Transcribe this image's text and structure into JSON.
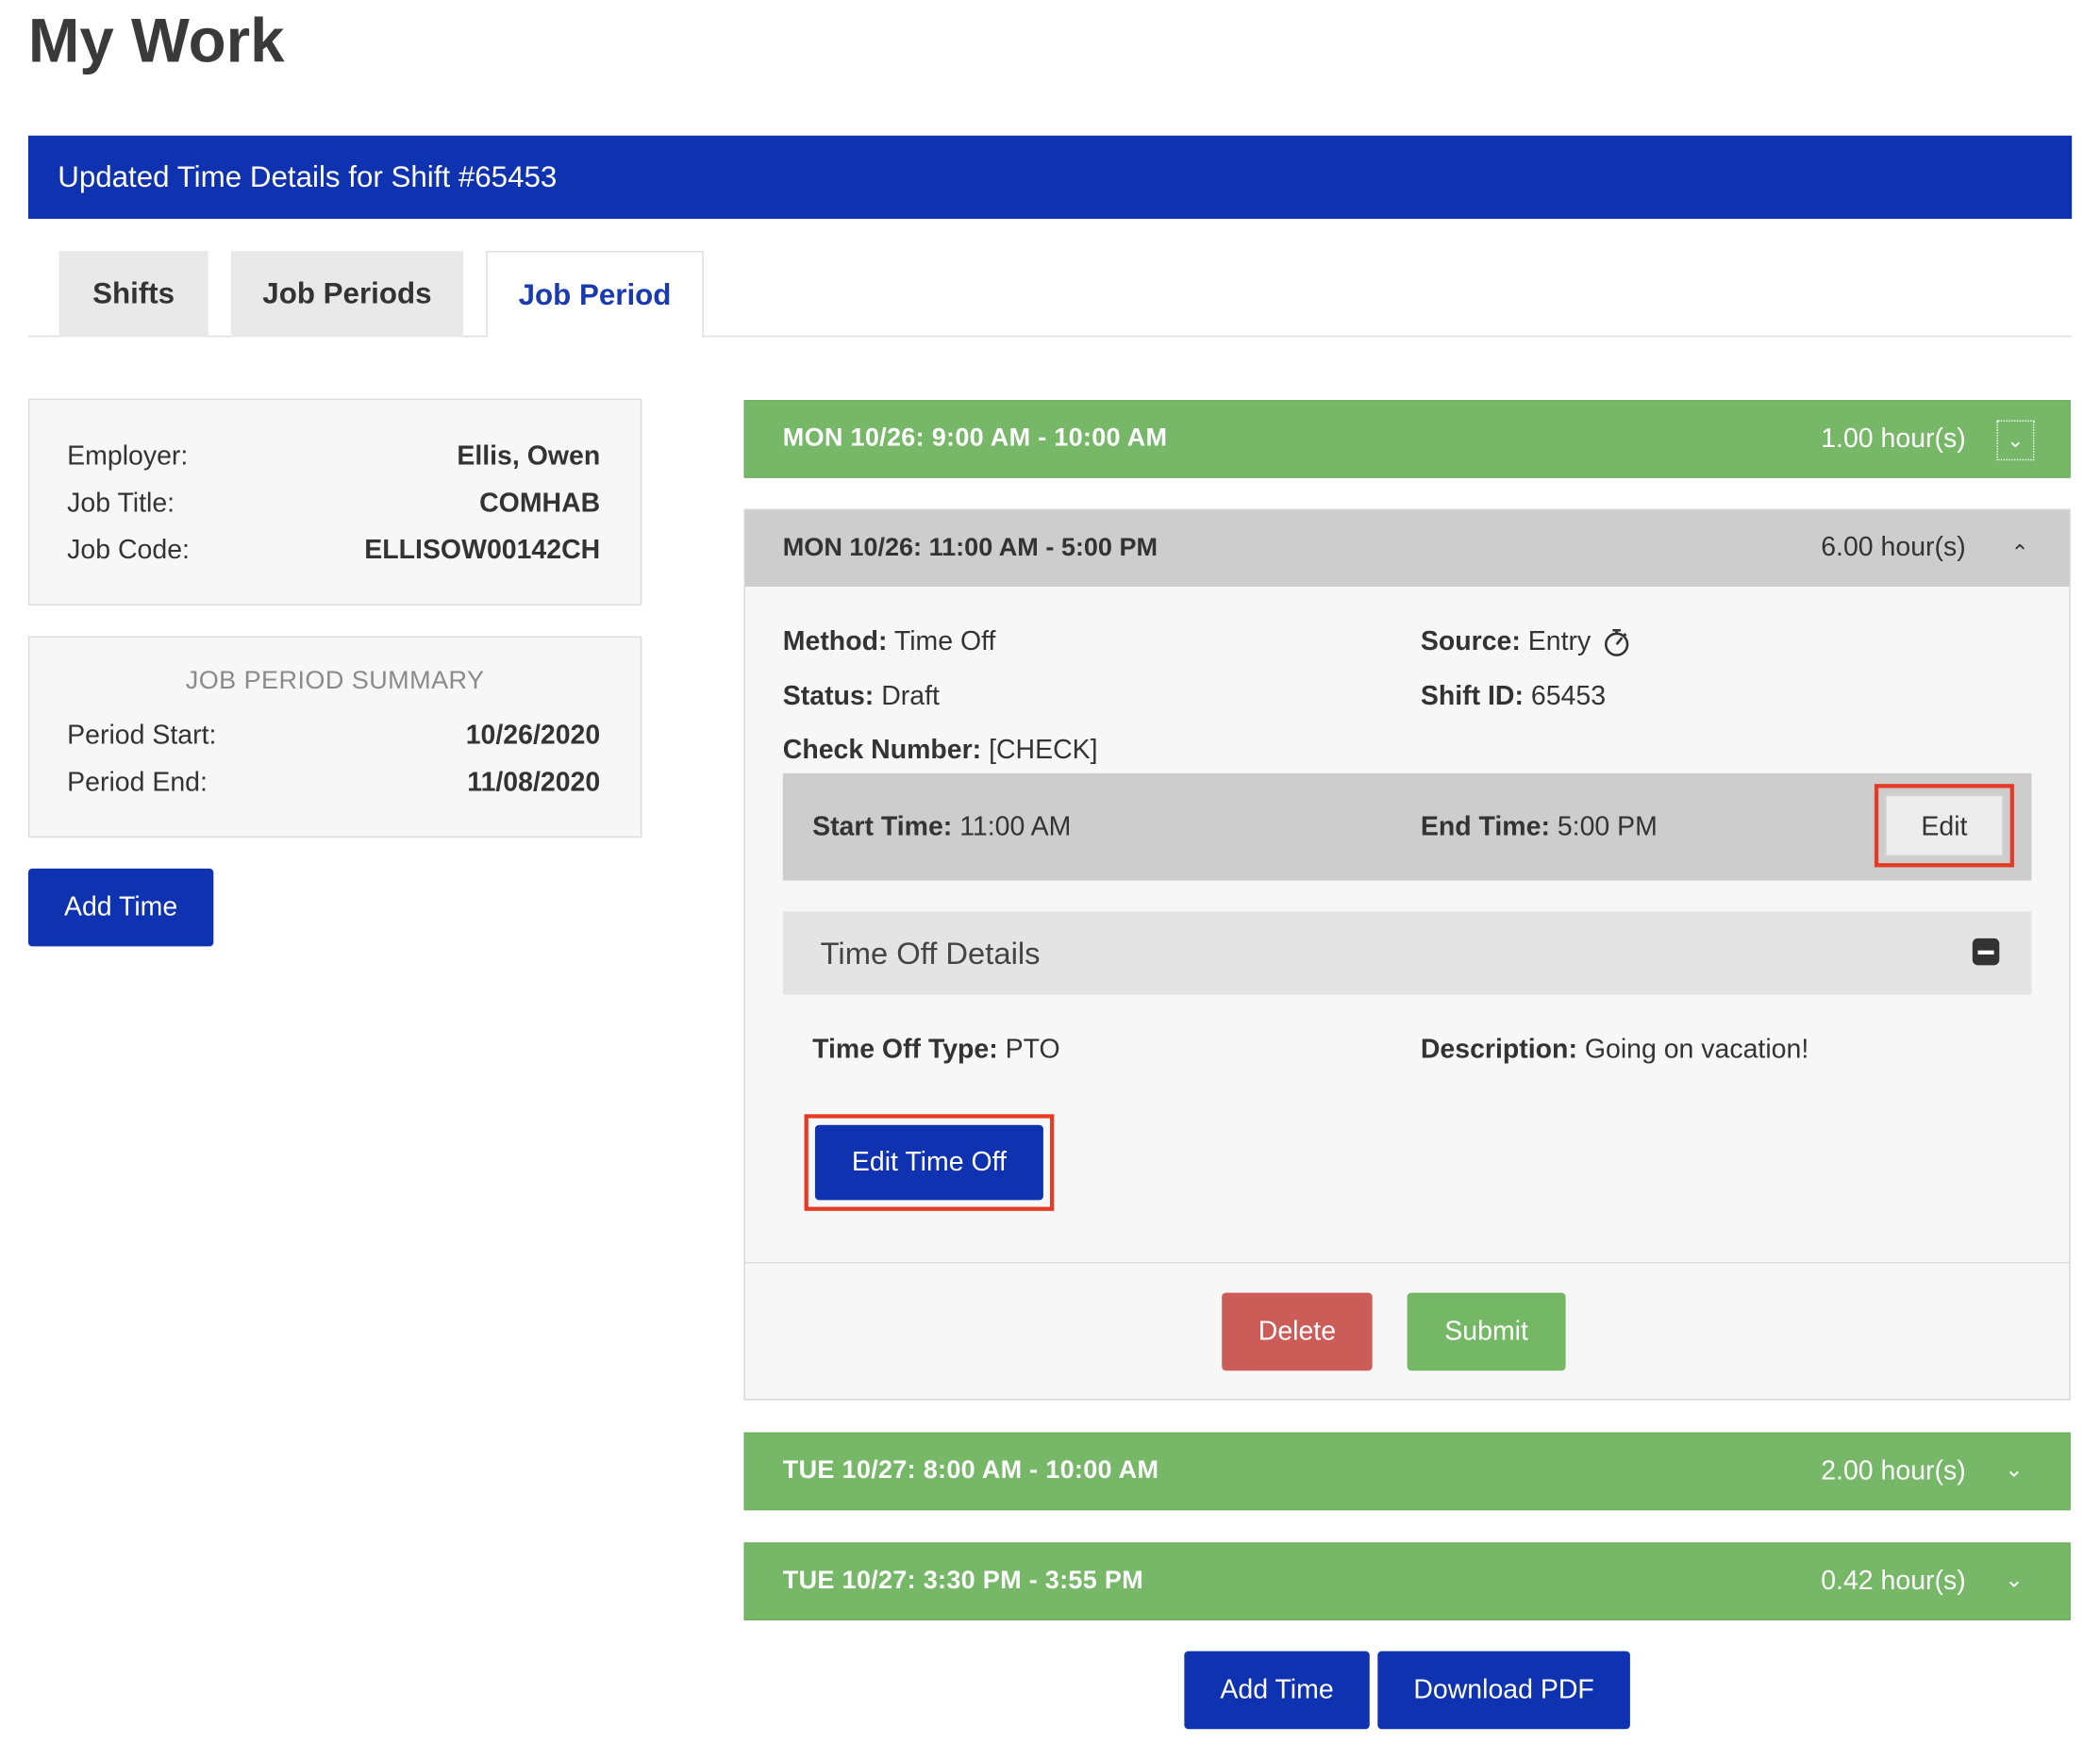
{
  "page": {
    "title": "My Work"
  },
  "banner": {
    "text": "Updated Time Details for Shift #65453"
  },
  "tabs": [
    {
      "label": "Shifts"
    },
    {
      "label": "Job Periods"
    },
    {
      "label": "Job Period"
    }
  ],
  "employee": {
    "employer_label": "Employer:",
    "employer_value": "Ellis, Owen",
    "job_title_label": "Job Title:",
    "job_title_value": "COMHAB",
    "job_code_label": "Job Code:",
    "job_code_value": "ELLISOW00142CH"
  },
  "summary": {
    "title": "JOB PERIOD SUMMARY",
    "start_label": "Period Start:",
    "start_value": "10/26/2020",
    "end_label": "Period End:",
    "end_value": "11/08/2020"
  },
  "left_add_time": "Add Time",
  "shifts": [
    {
      "label": "MON 10/26: 9:00 AM - 10:00 AM",
      "hours": "1.00 hour(s)",
      "chevron": "⌄"
    },
    {
      "label": "MON 10/26: 11:00 AM - 5:00 PM",
      "hours": "6.00 hour(s)",
      "chevron": "⌃"
    },
    {
      "label": "TUE 10/27: 8:00 AM - 10:00 AM",
      "hours": "2.00 hour(s)",
      "chevron": "⌄"
    },
    {
      "label": "TUE 10/27: 3:30 PM - 3:55 PM",
      "hours": "0.42 hour(s)",
      "chevron": "⌄"
    }
  ],
  "detail": {
    "method_label": "Method:",
    "method_value": "Time Off",
    "source_label": "Source:",
    "source_value": "Entry",
    "status_label": "Status:",
    "status_value": "Draft",
    "shift_id_label": "Shift ID:",
    "shift_id_value": "65453",
    "check_label": "Check Number:",
    "check_value": "[CHECK]",
    "start_label": "Start Time:",
    "start_value": "11:00 AM",
    "end_label": "End Time:",
    "end_value": "5:00 PM",
    "edit_button": "Edit",
    "time_off_header": "Time Off Details",
    "type_label": "Time Off Type:",
    "type_value": "PTO",
    "desc_label": "Description:",
    "desc_value": "Going on vacation!",
    "edit_time_off_button": "Edit Time Off",
    "delete_button": "Delete",
    "submit_button": "Submit"
  },
  "bottom": {
    "add_time": "Add Time",
    "download_pdf": "Download PDF"
  },
  "colors": {
    "primary": "#0f32b0",
    "success": "#76b867",
    "danger": "#cc5c57",
    "highlight": "#e53a23"
  }
}
